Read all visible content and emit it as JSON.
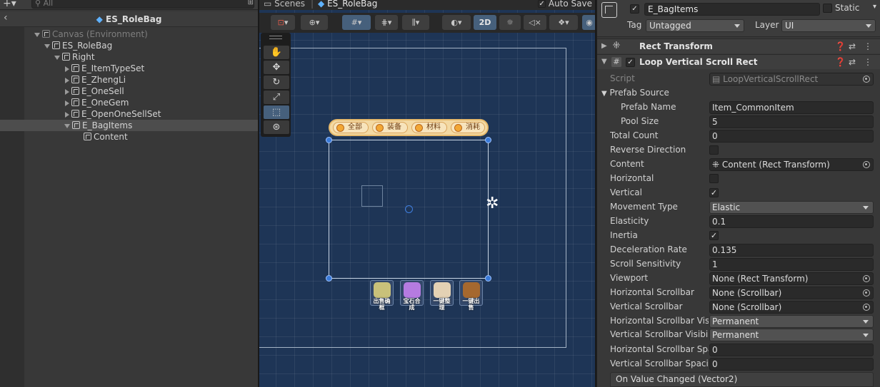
{
  "hierarchy": {
    "search_placeholder": "All",
    "scene_title": "ES_RoleBag",
    "items": [
      {
        "label": "Canvas (Environment)"
      },
      {
        "label": "ES_RoleBag"
      },
      {
        "label": "Right"
      },
      {
        "label": "E_ItemTypeSet"
      },
      {
        "label": "E_ZhengLi"
      },
      {
        "label": "E_OneSell"
      },
      {
        "label": "E_OneGem"
      },
      {
        "label": "E_OpenOneSellSet"
      },
      {
        "label": "E_BagItems"
      },
      {
        "label": "Content"
      }
    ]
  },
  "scene": {
    "tabs": [
      {
        "label": "Scenes"
      },
      {
        "label": "ES_RoleBag"
      }
    ],
    "auto_save_label": "Auto Save",
    "auto_save_checked": "✓",
    "mode_2d": "2D",
    "tab_buttons": [
      {
        "label": "全部"
      },
      {
        "label": "装备"
      },
      {
        "label": "材料"
      },
      {
        "label": "消耗"
      }
    ],
    "bottom_buttons": [
      {
        "label": "出售确框",
        "color": "#c9c17a"
      },
      {
        "label": "宝石合成",
        "color": "#b57be0"
      },
      {
        "label": "一键整理",
        "color": "#e3d1b4"
      },
      {
        "label": "一键出售",
        "color": "#a5682f"
      }
    ]
  },
  "inspector": {
    "object_name": "E_BagItems",
    "static_label": "Static",
    "tag_label": "Tag",
    "tag_value": "Untagged",
    "layer_label": "Layer",
    "layer_value": "UI",
    "components": [
      {
        "name": "Rect Transform"
      },
      {
        "name": "Loop Vertical Scroll Rect"
      }
    ],
    "props": {
      "script": {
        "label": "Script",
        "value": "LoopVerticalScrollRect"
      },
      "prefab_source": {
        "label": "Prefab Source"
      },
      "prefab_name": {
        "label": "Prefab Name",
        "value": "Item_CommonItem"
      },
      "pool_size": {
        "label": "Pool Size",
        "value": "5"
      },
      "total_count": {
        "label": "Total Count",
        "value": "0"
      },
      "reverse_direction": {
        "label": "Reverse Direction",
        "value": ""
      },
      "content": {
        "label": "Content",
        "value": "Content (Rect Transform)"
      },
      "horizontal": {
        "label": "Horizontal",
        "value": ""
      },
      "vertical": {
        "label": "Vertical",
        "value": "✓"
      },
      "movement_type": {
        "label": "Movement Type",
        "value": "Elastic"
      },
      "elasticity": {
        "label": "Elasticity",
        "value": "0.1"
      },
      "inertia": {
        "label": "Inertia",
        "value": "✓"
      },
      "deceleration_rate": {
        "label": "Deceleration Rate",
        "value": "0.135"
      },
      "scroll_sensitivity": {
        "label": "Scroll Sensitivity",
        "value": "1"
      },
      "viewport": {
        "label": "Viewport",
        "value": "None (Rect Transform)"
      },
      "h_scrollbar": {
        "label": "Horizontal Scrollbar",
        "value": "None (Scrollbar)"
      },
      "v_scrollbar": {
        "label": "Vertical Scrollbar",
        "value": "None (Scrollbar)"
      },
      "h_scrollbar_vis": {
        "label": "Horizontal Scrollbar Visil",
        "value": "Permanent"
      },
      "v_scrollbar_vis": {
        "label": "Vertical Scrollbar Visibili",
        "value": "Permanent"
      },
      "h_scrollbar_spacing": {
        "label": "Horizontal Scrollbar Spa",
        "value": "0"
      },
      "v_scrollbar_spacing": {
        "label": "Vertical Scrollbar Spacir",
        "value": "0"
      }
    },
    "event_label": "On Value Changed (Vector2)"
  }
}
